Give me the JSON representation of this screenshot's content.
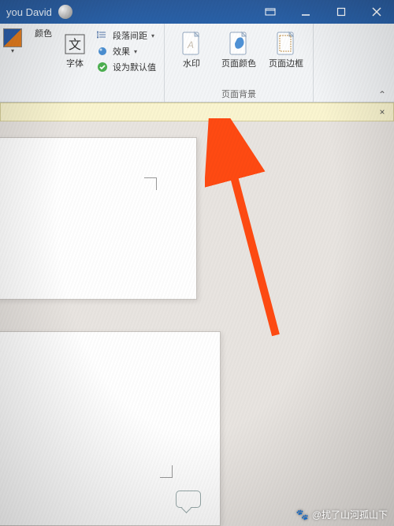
{
  "titlebar": {
    "user": "you David"
  },
  "ribbon": {
    "color_label": "颜色",
    "font_label": "字体",
    "para_spacing": "段落间距",
    "effects": "效果",
    "set_default": "设为默认值",
    "watermark": "水印",
    "page_color": "页面颜色",
    "page_border": "页面边框",
    "group_page_bg": "页面背景"
  },
  "msgbar": {
    "close": "×",
    "collapse": "⌃"
  },
  "credit": {
    "text": "@扰了山河孤山下"
  }
}
